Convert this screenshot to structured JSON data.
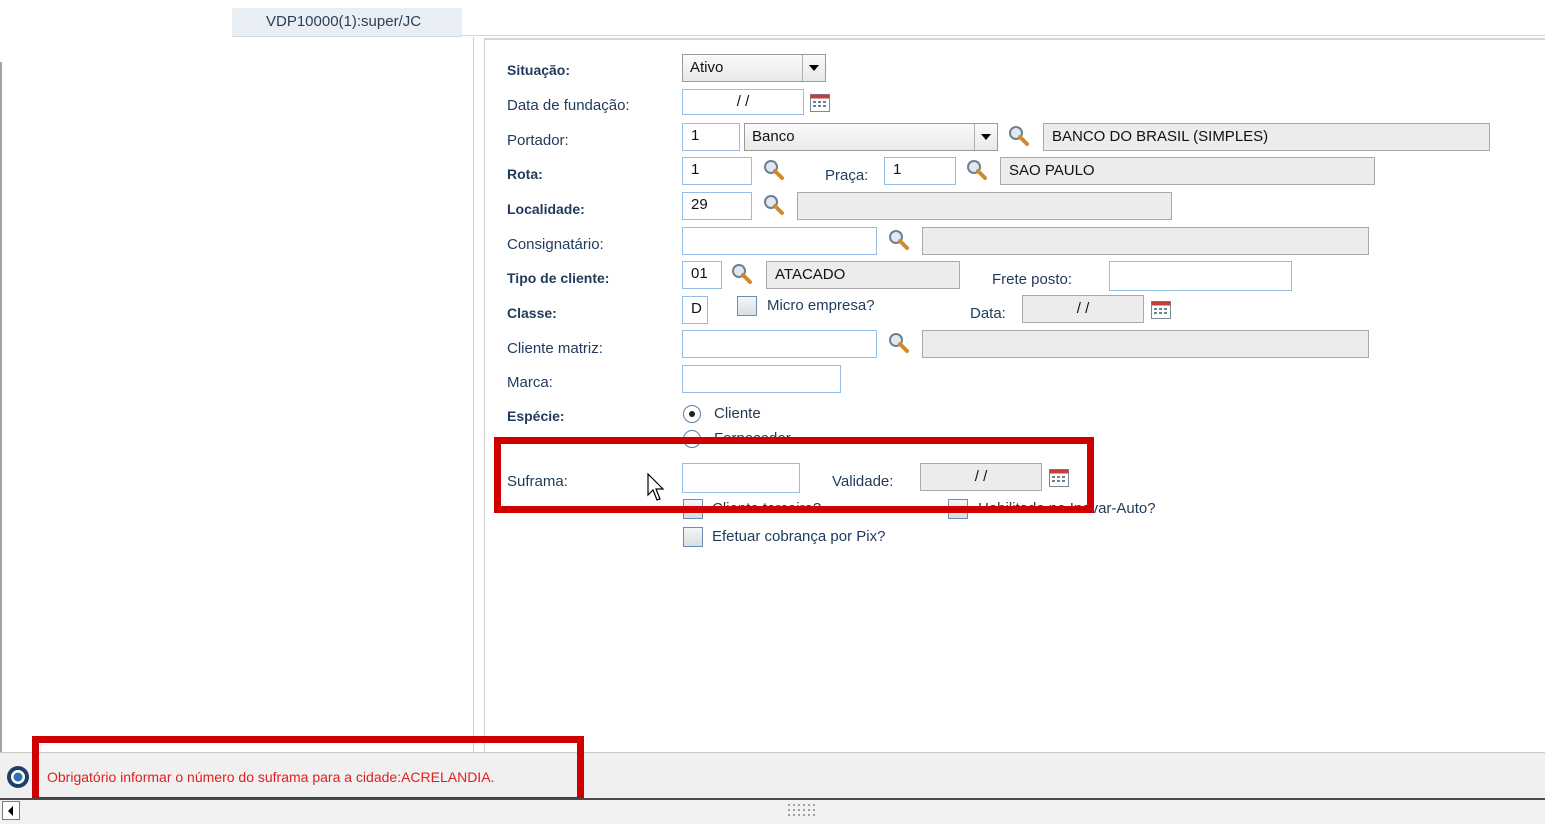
{
  "tab": {
    "title": "VDP10000(1):super/JC"
  },
  "form": {
    "situacao": {
      "label": "Situação:",
      "value": "Ativo"
    },
    "data_fundacao": {
      "label": "Data de fundação:",
      "value": "/ /"
    },
    "portador": {
      "label": "Portador:",
      "code": "1",
      "type": "Banco",
      "description": "BANCO DO BRASIL (SIMPLES)"
    },
    "rota": {
      "label": "Rota:",
      "code": "1"
    },
    "praca": {
      "label": "Praça:",
      "code": "1",
      "description": "SAO PAULO"
    },
    "localidade": {
      "label": "Localidade:",
      "code": "29",
      "description": ""
    },
    "consignatario": {
      "label": "Consignatário:",
      "code": "",
      "description": ""
    },
    "tipo_cliente": {
      "label": "Tipo de cliente:",
      "code": "01",
      "description": "ATACADO"
    },
    "frete_posto": {
      "label": "Frete posto:",
      "value": ""
    },
    "classe": {
      "label": "Classe:",
      "value": "D"
    },
    "micro_empresa": {
      "label": "Micro empresa?",
      "checked": false
    },
    "data": {
      "label": "Data:",
      "value": "/ /"
    },
    "cliente_matriz": {
      "label": "Cliente matriz:",
      "code": "",
      "description": ""
    },
    "marca": {
      "label": "Marca:",
      "value": ""
    },
    "especie": {
      "label": "Espécie:",
      "options": [
        "Cliente",
        "Fornecedor"
      ],
      "selected": "Cliente"
    },
    "suframa": {
      "label": "Suframa:",
      "value": ""
    },
    "validade": {
      "label": "Validade:",
      "value": "/ /"
    },
    "cliente_terceiro": {
      "label": "Cliente terceiro?",
      "checked": false
    },
    "habilitado": {
      "label": "Habilitado no Inovar-Auto?",
      "checked": false
    },
    "pix": {
      "label": "Efetuar cobrança por Pix?",
      "checked": false
    }
  },
  "status": {
    "message": "Obrigatório informar o número do suframa para a cidade:ACRELANDIA."
  },
  "colors": {
    "highlight": "#d10000",
    "error_text": "#e02020",
    "label": "#1f3a5a"
  }
}
